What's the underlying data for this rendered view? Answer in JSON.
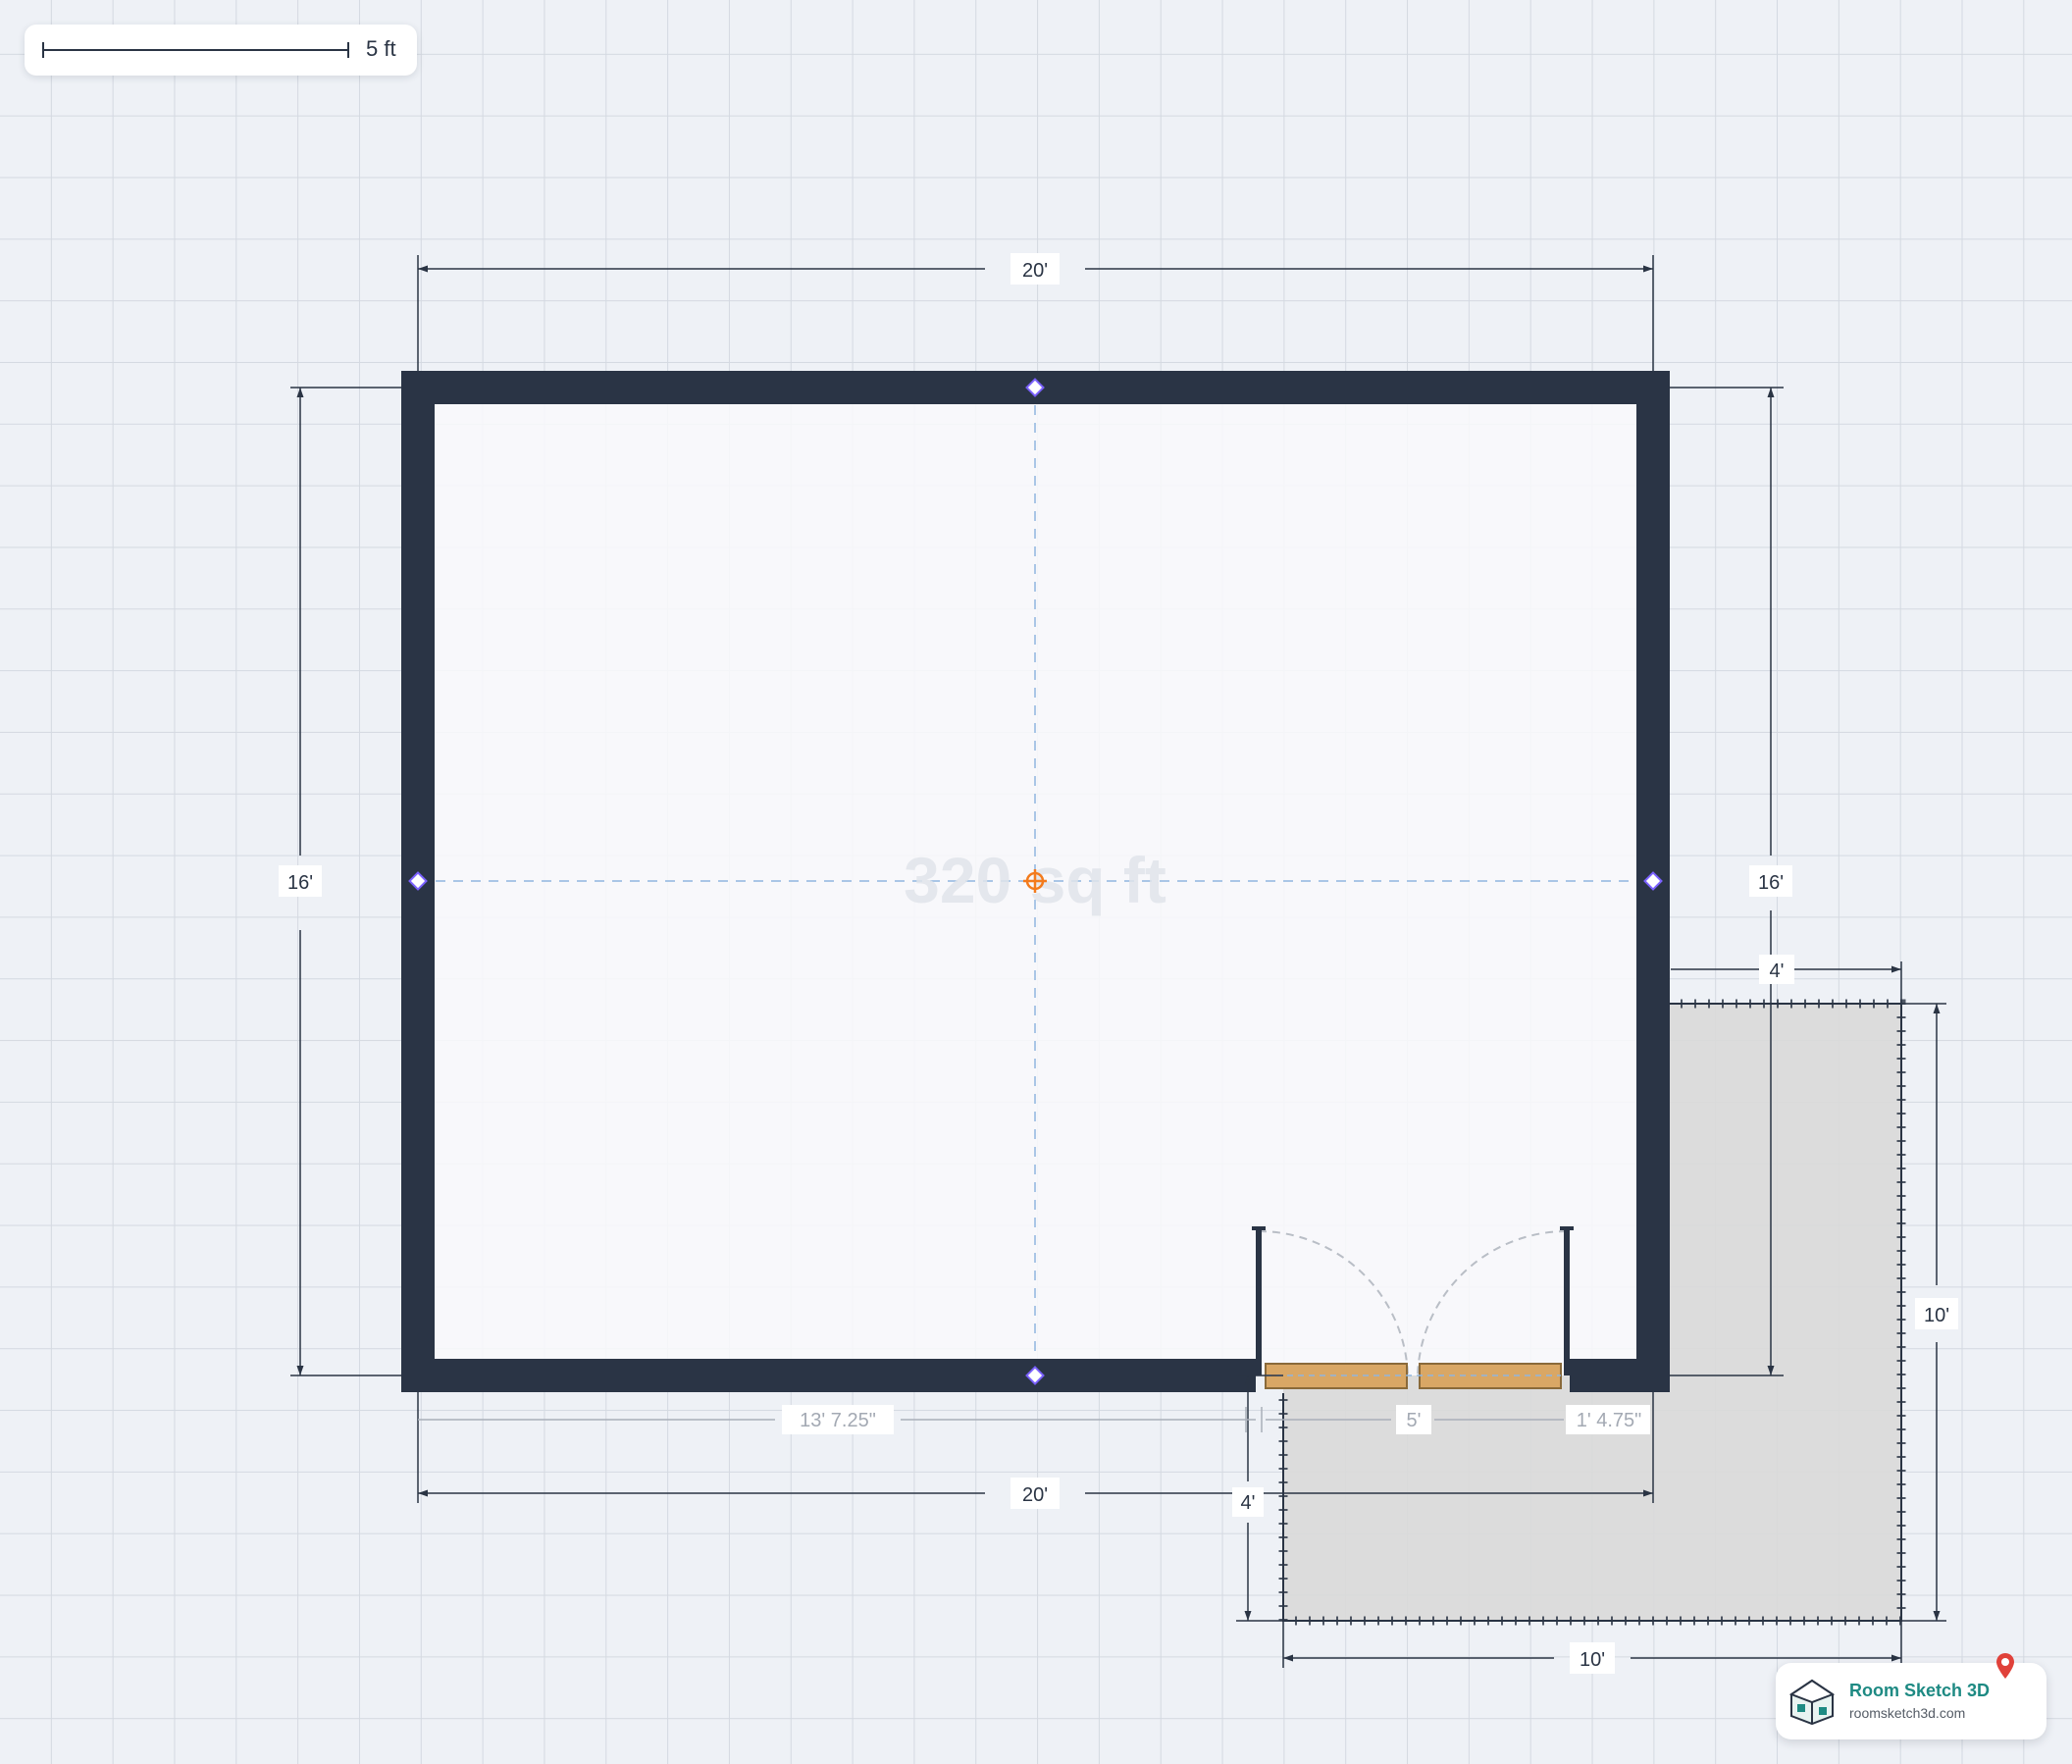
{
  "scale_bar": {
    "label": "5 ft"
  },
  "room": {
    "area_label": "320 sq ft",
    "dimensions": {
      "top_width": "20'",
      "bottom_width": "20'",
      "left_height": "16'",
      "right_height": "16'"
    },
    "door": {
      "left_offset": "13' 7.25\"",
      "width": "5'",
      "right_offset": "1' 4.75\""
    }
  },
  "zone": {
    "right_extent": "4'",
    "below_extent": "4'",
    "height": "10'",
    "width": "10'"
  },
  "brand": {
    "name": "Room Sketch 3D",
    "url": "roomsketch3d.com"
  },
  "colors": {
    "wall": "#2a3445",
    "handle": "#7b61ff",
    "center": "#f37b1d",
    "door_panel": "#d9a765",
    "zone_fill": "#d9d9d9",
    "brand": "#1e8a83"
  }
}
